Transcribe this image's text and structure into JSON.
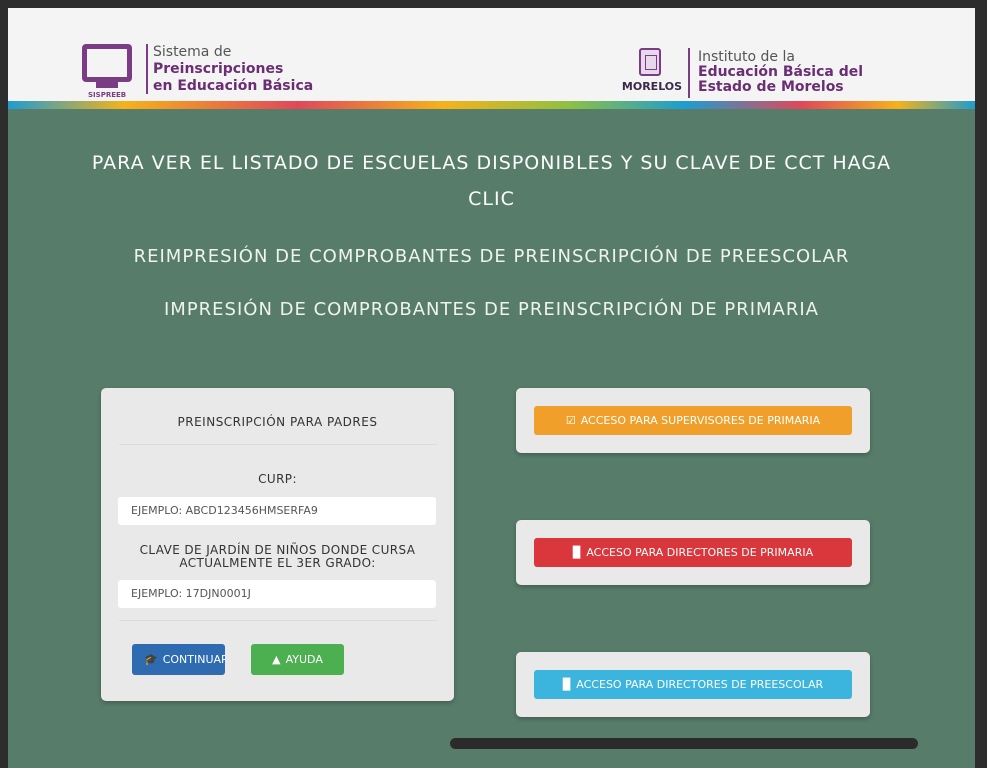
{
  "header": {
    "left": {
      "logo_text": "SISPREEB",
      "line1": "Sistema de",
      "line2": "Preinscripciones",
      "line3": "en Educación Básica"
    },
    "right": {
      "logo_text": "MORELOS",
      "line1": "Instituto de la",
      "line2": "Educación Básica del",
      "line3": "Estado de Morelos"
    }
  },
  "links": {
    "schools_line1": "PARA VER EL LISTADO DE ESCUELAS DISPONIBLES Y SU CLAVE DE CCT HAGA",
    "schools_line2": "CLIC",
    "reprint_preschool": "REIMPRESIÓN DE COMPROBANTES DE PREINSCRIPCIÓN DE PREESCOLAR",
    "print_primary": "IMPRESIÓN DE COMPROBANTES DE PREINSCRIPCIÓN DE PRIMARIA"
  },
  "form": {
    "title": "PREINSCRIPCIÓN PARA PADRES",
    "curp_label": "CURP:",
    "curp_placeholder": "EJEMPLO: ABCD123456HMSERFA9",
    "kinder_label_line1": "CLAVE DE JARDÍN DE NIÑOS DONDE CURSA",
    "kinder_label_line2": "ACTUALMENTE EL 3ER GRADO:",
    "kinder_placeholder": "EJEMPLO: 17DJN0001J",
    "continue_label": "CONTINUAR",
    "help_label": "AYUDA"
  },
  "access": {
    "supervisors": "ACCESO PARA SUPERVISORES DE PRIMARIA",
    "primary_directors": "ACCESO PARA DIRECTORES DE PRIMARIA",
    "preschool_directors": "ACCESO PARA DIRECTORES DE PREESCOLAR"
  },
  "colors": {
    "chalkboard": "#587c6a",
    "brand_purple": "#7a3d83",
    "orange": "#f0a02a",
    "red": "#d9373c",
    "cyan": "#3bb5dd",
    "blue": "#2e6bb0",
    "green": "#4caf50"
  }
}
